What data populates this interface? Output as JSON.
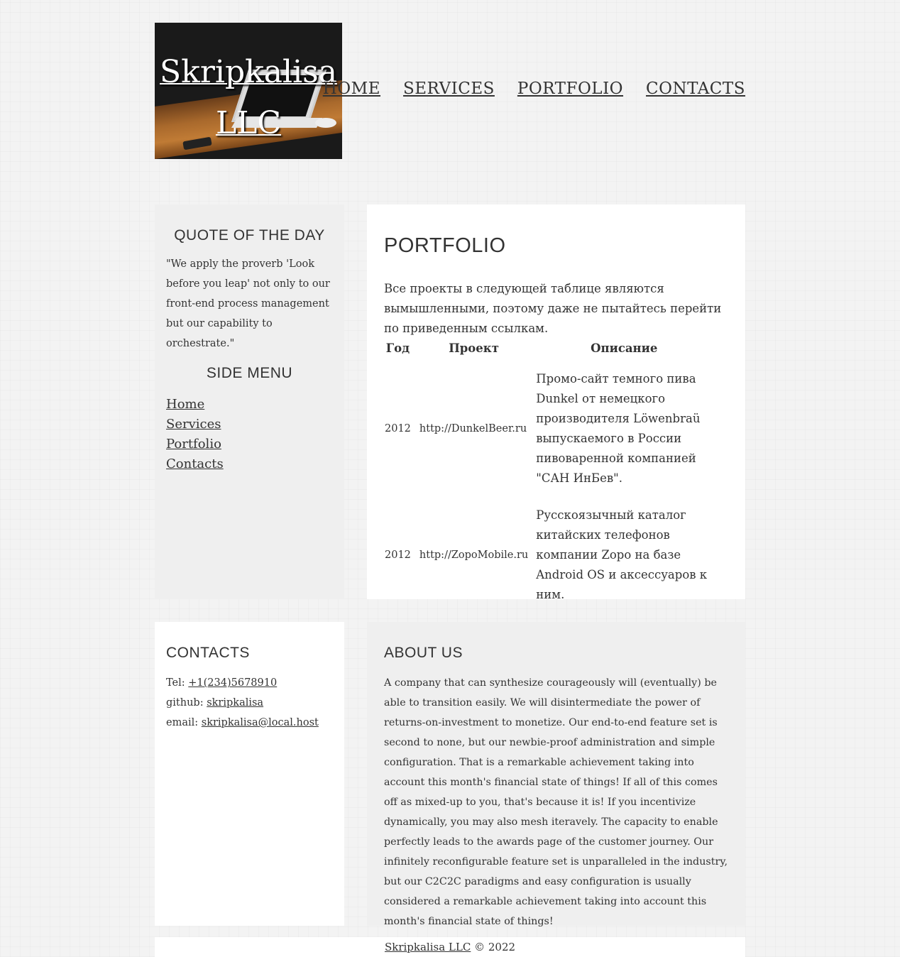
{
  "header": {
    "logo_title": "Skripkalisa LLC",
    "nav": [
      "HOME",
      "SERVICES",
      "PORTFOLIO",
      "CONTACTS"
    ]
  },
  "sidebar": {
    "quote_heading": "QUOTE OF THE DAY",
    "quote_text": "\"We apply the proverb 'Look before you leap' not only to our front-end process management but our capability to orchestrate.\"",
    "menu_heading": "SIDE MENU",
    "menu": [
      "Home",
      "Services",
      "Portfolio",
      "Contacts"
    ]
  },
  "main": {
    "title": "PORTFOLIO",
    "intro": "Все проекты в следующей таблице являются вымышленными, поэтому даже не пытайтесь перейти по приведенным ссылкам.",
    "table": {
      "headers": [
        "Год",
        "Проект",
        "Описание"
      ],
      "rows": [
        {
          "year": "2012",
          "project": "http://DunkelBeer.ru",
          "description": "Промо-сайт темного пива Dunkel от немецкого производителя Löwenbraü выпускаемого в России пивоваренной компанией \"САН ИнБев\"."
        },
        {
          "year": "2012",
          "project": "http://ZopoMobile.ru",
          "description": "Русскоязычный каталог китайских телефонов компании Zopo на базе Android OS и аксессуаров к ним."
        }
      ]
    }
  },
  "contacts": {
    "heading": "CONTACTS",
    "tel_label": "Tel: ",
    "tel_value": "+1(234)5678910",
    "github_label": "github: ",
    "github_value": "skripkalisa",
    "email_label": "email: ",
    "email_value": "skripkalisa@local.host"
  },
  "about": {
    "heading": "ABOUT US",
    "text": "A company that can synthesize courageously will (eventually) be able to transition easily. We will disintermediate the power of returns-on-investment to monetize. Our end-to-end feature set is second to none, but our newbie-proof administration and simple configuration. That is a remarkable achievement taking into account this month's financial state of things! If all of this comes off as mixed-up to you, that's because it is! If you incentivize dynamically, you may also mesh iteravely. The capacity to enable perfectly leads to the awards page of the customer journey. Our infinitely reconfigurable feature set is unparalleled in the industry, but our C2C2C paradigms and easy configuration is usually considered a remarkable achievement taking into account this month's financial state of things!"
  },
  "footer": {
    "link": "Skripkalisa LLC",
    "copyright": " © 2022"
  }
}
